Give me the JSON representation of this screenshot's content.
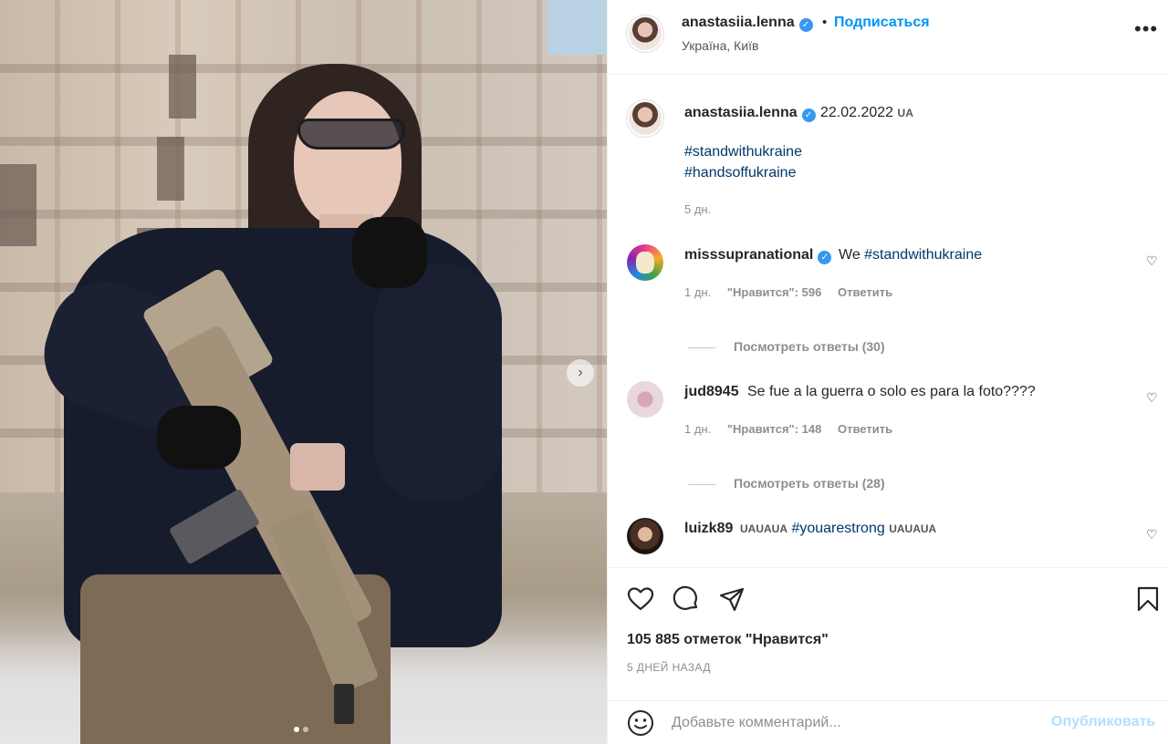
{
  "post": {
    "username": "anastasiia.lenna",
    "follow_label": "Подписаться",
    "separator": "•",
    "location": "Україна, Київ",
    "more_label": "•••"
  },
  "caption": {
    "username": "anastasiia.lenna",
    "date": "22.02.2022",
    "flag": "UA",
    "hashtag1": "#standwithukraine",
    "hashtag2": "#handsoffukraine",
    "time": "5 дн."
  },
  "comments": [
    {
      "username": "misssupranational",
      "text_prefix": "We ",
      "hashtag": "#standwithukraine",
      "time": "1 дн.",
      "likes_label": "\"Нравится\": 596",
      "reply_label": "Ответить",
      "view_replies": "Посмотреть ответы (30)"
    },
    {
      "username": "jud8945",
      "text": "Se fue a la guerra o solo es para la foto????",
      "time": "1 дн.",
      "likes_label": "\"Нравится\": 148",
      "reply_label": "Ответить",
      "view_replies": "Посмотреть ответы (28)"
    },
    {
      "username": "luizk89",
      "flags_before": "UAUAUA",
      "hashtag": "#youarestrong",
      "flags_after": "UAUAUA"
    }
  ],
  "actions": {
    "likes_text": "105 885 отметок \"Нравится\"",
    "time_ago": "5 ДНЕЙ НАЗАД"
  },
  "add_comment": {
    "placeholder": "Добавьте комментарий...",
    "publish_label": "Опубликовать"
  },
  "icons": {
    "verified": "✓",
    "next": "›",
    "heart_small": "♡"
  },
  "colors": {
    "link_blue": "#0095f6",
    "hashtag": "#00376b",
    "verified": "#3897f0",
    "publish_disabled": "#b2dffc"
  }
}
